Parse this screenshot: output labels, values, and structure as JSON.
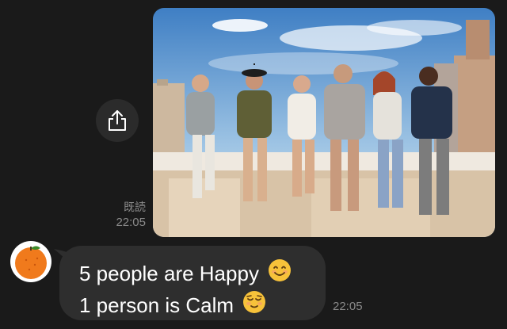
{
  "sent_message": {
    "image_icon": "photo-of-six-friends-on-rooftop",
    "share_icon": "share-icon",
    "read_receipt": "既読",
    "time": "22:05"
  },
  "received_message": {
    "avatar_icon": "tangerine-icon",
    "lines": [
      {
        "text": "5 people are Happy",
        "emoji_icon": "smiling-face-icon"
      },
      {
        "text": "1 person is Calm",
        "emoji_icon": "relieved-face-icon"
      }
    ],
    "time": "22:05"
  },
  "colors": {
    "background": "#1a1a1a",
    "bubble": "#2e2e2e",
    "timestamp": "#8a8a8a",
    "avatar_fruit": "#f07a1c"
  }
}
